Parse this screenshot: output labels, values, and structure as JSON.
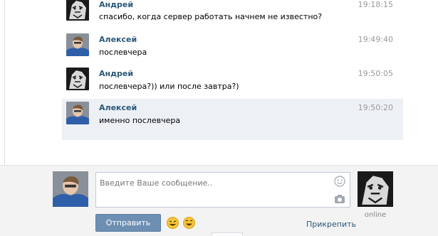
{
  "messages": [
    {
      "author": "Андрей",
      "text": "спасибо, когда сервер работать начнем не известно?",
      "time": "19:18:15",
      "avatar": "tiger"
    },
    {
      "author": "Алексей",
      "text": "послевчера",
      "time": "19:49:40",
      "avatar": "person"
    },
    {
      "author": "Андрей",
      "text": "послевчера?)) или после завтра?)",
      "time": "19:50:05",
      "avatar": "tiger"
    },
    {
      "author": "Алексей",
      "text": "именно послевчера",
      "time": "19:50:20",
      "avatar": "person",
      "selected": true
    }
  ],
  "composer": {
    "placeholder": "Введите Ваше сообщение..",
    "send_label": "Отправить",
    "attach_label": "Прикрепить",
    "partner_status": "online"
  },
  "icons": [
    "smile-icon",
    "camera-icon",
    "emoji-grin-icon",
    "emoji-laugh-icon"
  ],
  "colors": {
    "author": "#2b587a",
    "selected_bg": "#edf1f5",
    "send_button": "#6d8fb3"
  }
}
